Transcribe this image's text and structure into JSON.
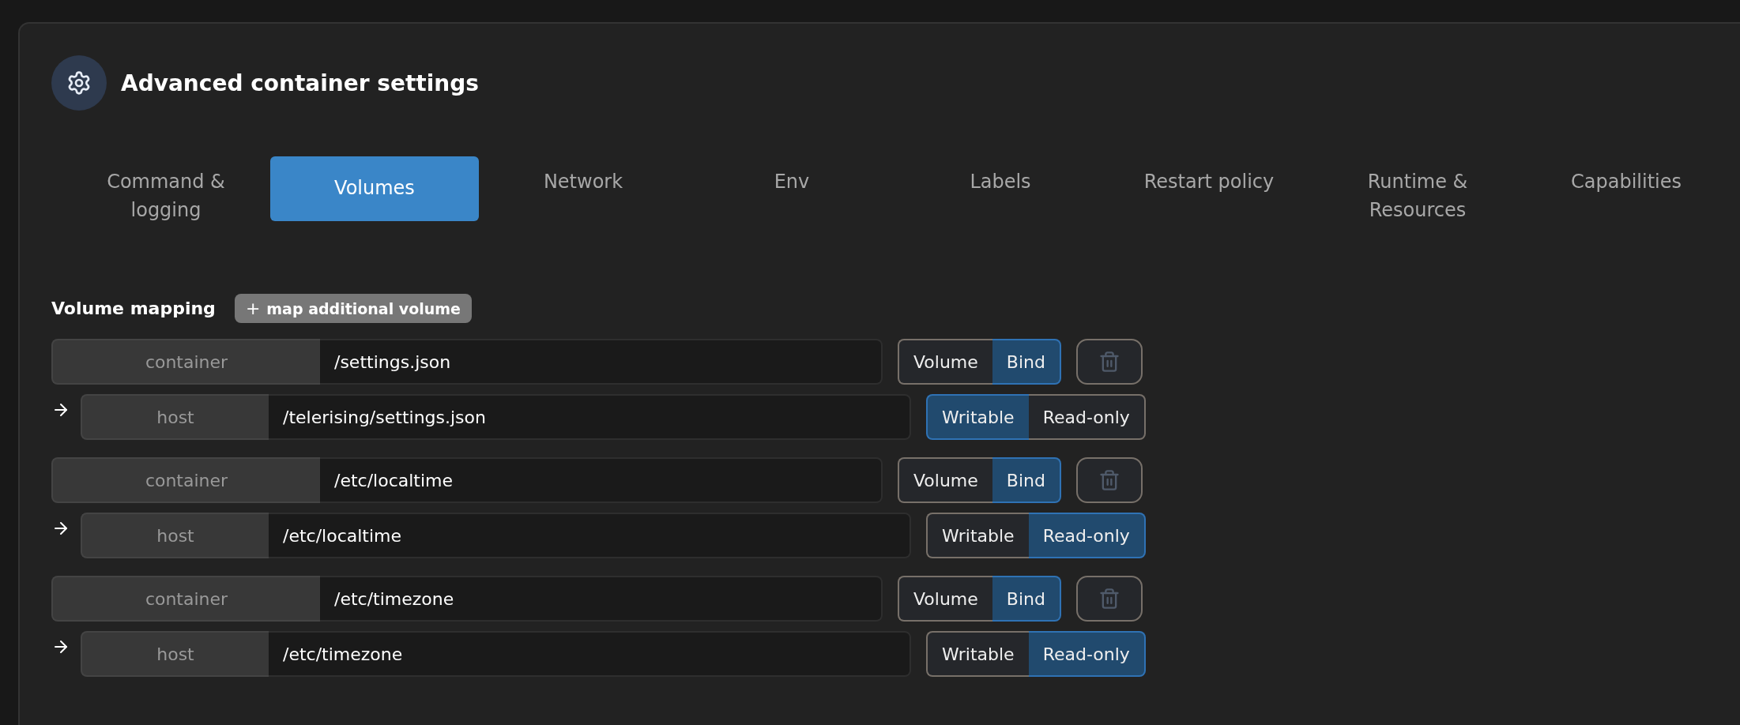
{
  "panel": {
    "title": "Advanced container settings"
  },
  "tabs": [
    {
      "label": "Command & logging",
      "selected": false
    },
    {
      "label": "Volumes",
      "selected": true
    },
    {
      "label": "Network",
      "selected": false
    },
    {
      "label": "Env",
      "selected": false
    },
    {
      "label": "Labels",
      "selected": false
    },
    {
      "label": "Restart policy",
      "selected": false
    },
    {
      "label": "Runtime & Resources",
      "selected": false
    },
    {
      "label": "Capabilities",
      "selected": false
    }
  ],
  "volume_mapping": {
    "label": "Volume mapping",
    "add_button": "map additional volume",
    "add_icon": "+"
  },
  "volumes": [
    {
      "container_label": "container",
      "container_path": "/settings.json",
      "host_label": "host",
      "host_path": "/telerising/settings.json",
      "type_options": [
        {
          "label": "Volume",
          "selected": false
        },
        {
          "label": "Bind",
          "selected": true
        }
      ],
      "access_options": [
        {
          "label": "Writable",
          "selected": true
        },
        {
          "label": "Read-only",
          "selected": false
        }
      ],
      "remove_disabled": true
    },
    {
      "container_label": "container",
      "container_path": "/etc/localtime",
      "host_label": "host",
      "host_path": "/etc/localtime",
      "type_options": [
        {
          "label": "Volume",
          "selected": false
        },
        {
          "label": "Bind",
          "selected": true
        }
      ],
      "access_options": [
        {
          "label": "Writable",
          "selected": false
        },
        {
          "label": "Read-only",
          "selected": true
        }
      ],
      "remove_disabled": true
    },
    {
      "container_label": "container",
      "container_path": "/etc/timezone",
      "host_label": "host",
      "host_path": "/etc/timezone",
      "type_options": [
        {
          "label": "Volume",
          "selected": false
        },
        {
          "label": "Bind",
          "selected": true
        }
      ],
      "access_options": [
        {
          "label": "Writable",
          "selected": false
        },
        {
          "label": "Read-only",
          "selected": true
        }
      ],
      "remove_disabled": true
    }
  ]
}
